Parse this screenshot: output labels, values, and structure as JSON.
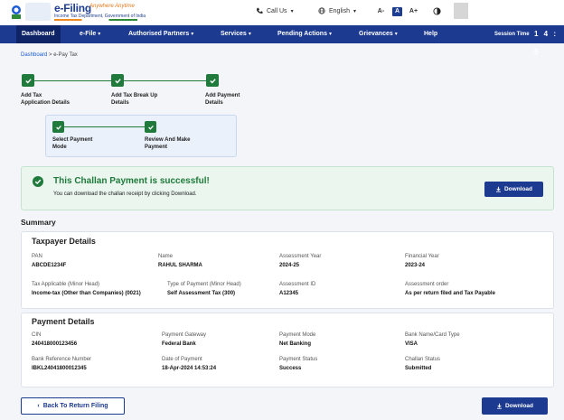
{
  "header": {
    "logo_title": "e-Filing",
    "logo_tagline": "Anywhere Anytime",
    "logo_subtitle": "Income Tax Department, Government of India",
    "call_us": "Call Us",
    "language": "English",
    "font_small": "A-",
    "font_normal": "A",
    "font_large": "A+"
  },
  "nav": {
    "items": [
      {
        "label": "Dashboard"
      },
      {
        "label": "e-File"
      },
      {
        "label": "Authorised Partners"
      },
      {
        "label": "Services"
      },
      {
        "label": "Pending Actions"
      },
      {
        "label": "Grievances"
      },
      {
        "label": "Help"
      }
    ],
    "session_label": "Session Time",
    "session_value": "1 4 : 5"
  },
  "breadcrumb": {
    "home": "Dashboard",
    "separator": ">",
    "current": "e-Pay Tax"
  },
  "steps": {
    "main": [
      {
        "label_line1": "Add Tax",
        "label_line2": "Application Details"
      },
      {
        "label_line1": "Add Tax Break Up",
        "label_line2": "Details"
      },
      {
        "label_line1": "Add Payment",
        "label_line2": "Details"
      }
    ],
    "sub": [
      {
        "label_line1": "Select Payment",
        "label_line2": "Mode"
      },
      {
        "label_line1": "Review And Make",
        "label_line2": "Payment"
      }
    ]
  },
  "success": {
    "title": "This Challan Payment is successful!",
    "message": "You can download the challan receipt by clicking Download.",
    "download_label": "Download"
  },
  "summary": {
    "title": "Summary",
    "taxpayer": {
      "title": "Taxpayer Details",
      "pan_label": "PAN",
      "pan": "ABCDE1234F",
      "name_label": "Name",
      "name": "RAHUL SHARMA",
      "ay_label": "Assessment Year",
      "ay": "2024-25",
      "fy_label": "Financial Year",
      "fy": "2023-24",
      "tax_app_label": "Tax Applicable (Minor Head)",
      "tax_app": "Income-tax (Other than Companies) (0021)",
      "pay_type_label": "Type of Payment (Minor Head)",
      "pay_type": "Self Assessment Tax (300)",
      "assess_id_label": "Assessment ID",
      "assess_id": "A12345",
      "assess_order_label": "Assessment order",
      "assess_order": "As per return filed and Tax Payable"
    },
    "payment": {
      "title": "Payment Details",
      "cin_label": "CIN",
      "cin": "240418000123456",
      "gateway_label": "Payment Gateway",
      "gateway": "Federal Bank",
      "mode_label": "Payment Mode",
      "mode": "Net Banking",
      "bank_label": "Bank Name/Card Type",
      "bank": "VISA",
      "brn_label": "Bank Reference Number",
      "brn": "IBKL24041800012345",
      "date_label": "Date of Payment",
      "date": "18-Apr-2024 14:53:24",
      "status_label": "Payment Status",
      "status": "Success",
      "challan_label": "Challan Status",
      "challan": "Submitted"
    }
  },
  "footer": {
    "back_label": "Back To Return Filing",
    "download_label": "Download"
  },
  "colors": {
    "primary": "#1c3a8f",
    "success": "#1f7a3b"
  }
}
